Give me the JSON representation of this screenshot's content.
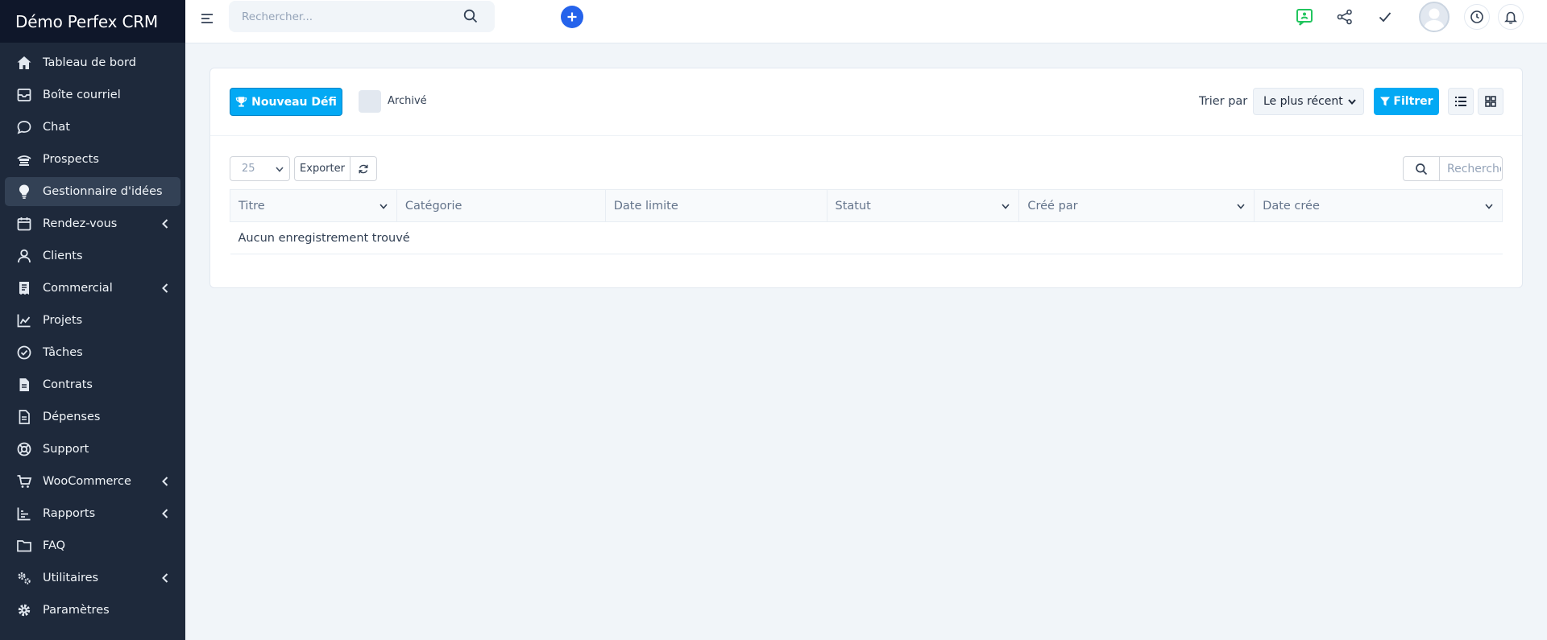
{
  "app": {
    "brand": "Démo Perfex CRM"
  },
  "sidebar": {
    "items": [
      {
        "label": "Tableau de bord",
        "icon": "home-icon"
      },
      {
        "label": "Boîte courriel",
        "icon": "mail-icon"
      },
      {
        "label": "Chat",
        "icon": "chat-icon"
      },
      {
        "label": "Prospects",
        "icon": "prospects-icon"
      },
      {
        "label": "Gestionnaire d'idées",
        "icon": "lightbulb-icon",
        "active": true
      },
      {
        "label": "Rendez-vous",
        "icon": "calendar-icon",
        "expandable": true
      },
      {
        "label": "Clients",
        "icon": "user-icon"
      },
      {
        "label": "Commercial",
        "icon": "receipt-icon",
        "expandable": true
      },
      {
        "label": "Projets",
        "icon": "chart-icon"
      },
      {
        "label": "Tâches",
        "icon": "check-circle-icon"
      },
      {
        "label": "Contrats",
        "icon": "contract-icon"
      },
      {
        "label": "Dépenses",
        "icon": "expense-icon"
      },
      {
        "label": "Support",
        "icon": "lifebuoy-icon"
      },
      {
        "label": "WooCommerce",
        "icon": "cart-icon",
        "expandable": true
      },
      {
        "label": "Rapports",
        "icon": "bar-chart-icon",
        "expandable": true
      },
      {
        "label": "FAQ",
        "icon": "folder-icon"
      },
      {
        "label": "Utilitaires",
        "icon": "cogs-icon",
        "expandable": true
      },
      {
        "label": "Paramètres",
        "icon": "gear-icon"
      }
    ]
  },
  "topbar": {
    "search_placeholder": "Rechercher..."
  },
  "toolbar": {
    "new_label": "Nouveau Défi",
    "archive_label": "Archivé",
    "sort_label": "Trier par",
    "sort_value": "Le plus récent",
    "filter_label": "Filtrer"
  },
  "table": {
    "page_size": "25",
    "export_label": "Exporter",
    "search_placeholder": "Rechercher",
    "columns": [
      "Titre",
      "Catégorie",
      "Date limite",
      "Statut",
      "Créé par",
      "Date crée"
    ],
    "empty_message": "Aucun enregistrement trouvé"
  },
  "colors": {
    "sidebar_bg": "#1e293b",
    "brand_bg": "#0f172a",
    "accent": "#03a9f4",
    "primary": "#2563eb"
  }
}
